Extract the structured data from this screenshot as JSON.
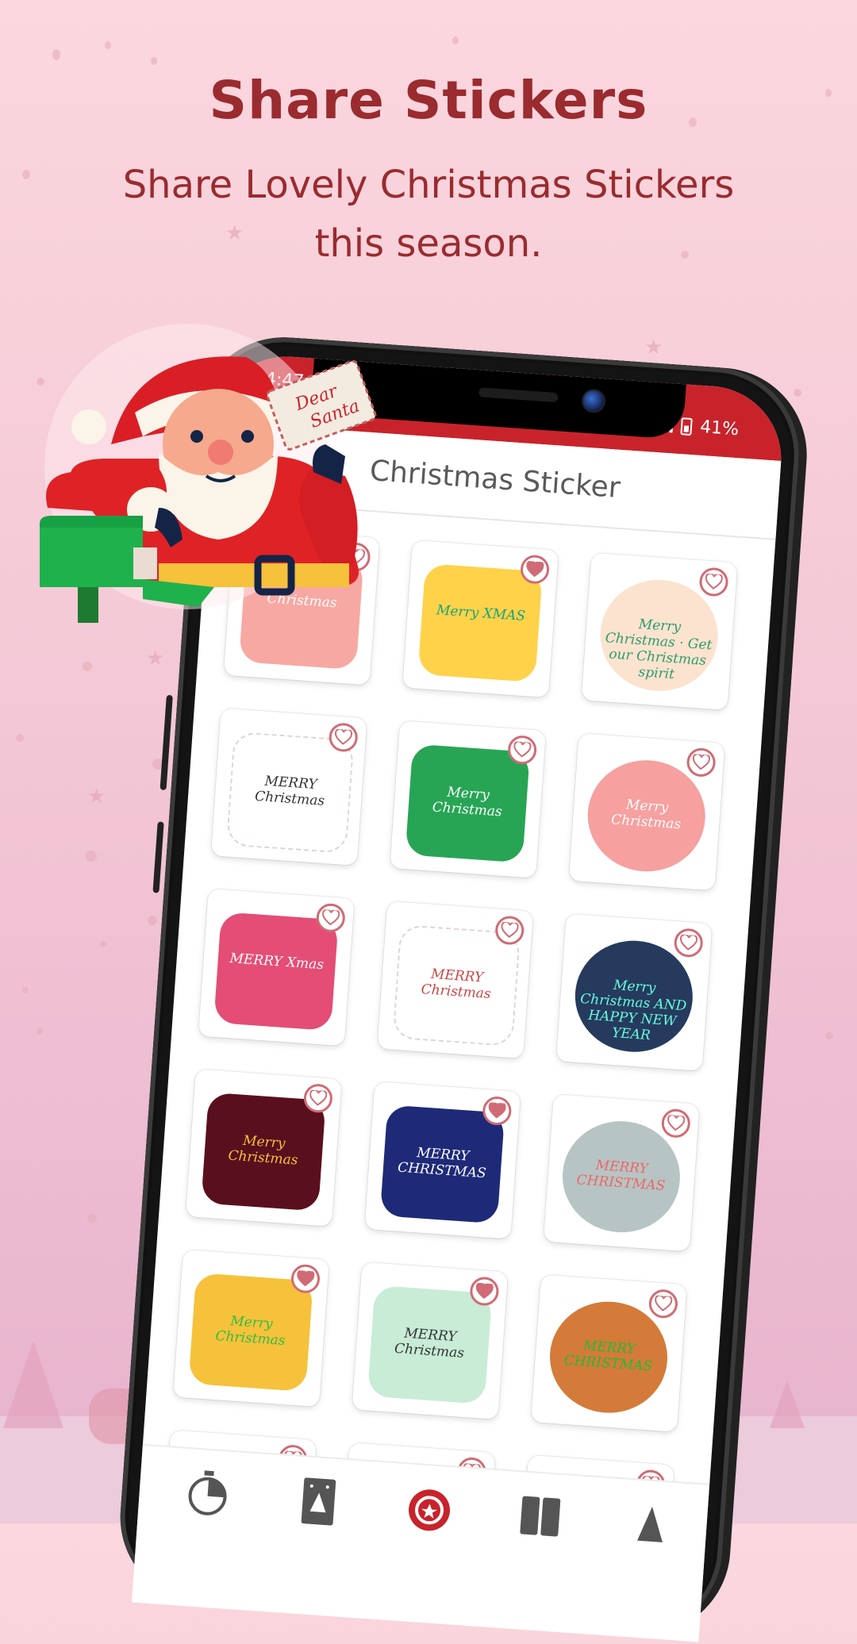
{
  "promo": {
    "title": "Share Stickers",
    "subtitle_line1": "Share Lovely Christmas Stickers",
    "subtitle_line2": "this season."
  },
  "colors": {
    "title": "#9a2b2f",
    "status_bar": "#c8232b",
    "heart": "#d06b75",
    "background": "#f4c8d6"
  },
  "phone": {
    "status_bar": {
      "time": "4:47",
      "battery": "41%",
      "signal_icon": "signal-icon",
      "battery_icon": "battery-charging-icon"
    },
    "app_title": "Christmas Sticker",
    "stickers": [
      {
        "name": "merry-christmas-cupcake",
        "caption": "Christmas",
        "favorite": false
      },
      {
        "name": "merry-xmas-stocking",
        "caption": "Merry XMAS",
        "favorite": true
      },
      {
        "name": "merry-christmas-cocoa",
        "caption": "Merry Christmas · Get our Christmas spirit",
        "favorite": false
      },
      {
        "name": "merry-christmas-gift",
        "caption": "MERRY Christmas",
        "favorite": false
      },
      {
        "name": "merry-christmas-santa",
        "caption": "Merry Christmas",
        "favorite": false
      },
      {
        "name": "merry-christmas-snowman",
        "caption": "Merry Christmas",
        "favorite": false
      },
      {
        "name": "merry-xmas-gingerbread",
        "caption": "MERRY Xmas",
        "favorite": false
      },
      {
        "name": "merry-christmas-wreath",
        "caption": "MERRY Christmas",
        "favorite": false
      },
      {
        "name": "merry-christmas-elves",
        "caption": "Merry Christmas AND HAPPY NEW YEAR",
        "favorite": false
      },
      {
        "name": "merry-christmas-sock",
        "caption": "Merry Christmas",
        "favorite": false
      },
      {
        "name": "merry-christmas-snowglobe",
        "caption": "MERRY CHRISTMAS",
        "favorite": true
      },
      {
        "name": "merry-christmas-car",
        "caption": "MERRY CHRISTMAS",
        "favorite": false
      },
      {
        "name": "merry-christmas-bell",
        "caption": "Merry Christmas",
        "favorite": true
      },
      {
        "name": "merry-christmas-santa-sign",
        "caption": "MERRY Christmas",
        "favorite": true
      },
      {
        "name": "merry-christmas-mug",
        "caption": "MERRY CHRISTMAS",
        "favorite": false
      },
      {
        "name": "merry-christmas-ornament",
        "caption": "MERRY CHRISTMAS",
        "favorite": false
      },
      {
        "name": "snowman",
        "caption": "",
        "favorite": false
      },
      {
        "name": "snow-house",
        "caption": "",
        "favorite": false
      }
    ],
    "bottom_nav": [
      {
        "icon": "timer-icon",
        "active": false
      },
      {
        "icon": "card-tree-icon",
        "active": false
      },
      {
        "icon": "sticker-badge-icon",
        "active": true
      },
      {
        "icon": "grid-icon",
        "active": false
      },
      {
        "icon": "more-icon",
        "active": false
      }
    ]
  },
  "illustration": {
    "letter_text_1": "Dear",
    "letter_text_2": "Santa"
  }
}
